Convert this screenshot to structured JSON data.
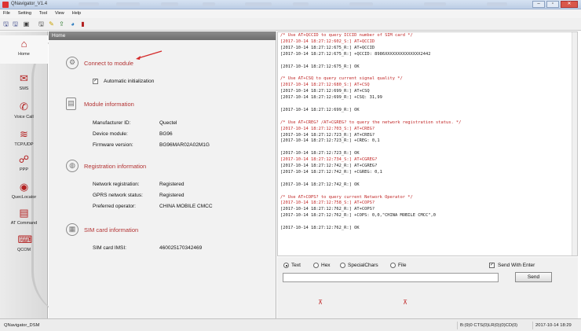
{
  "window": {
    "title": "QNavigator_V1.4"
  },
  "menu": [
    "File",
    "Setting",
    "Tool",
    "View",
    "Help"
  ],
  "toolbar": {
    "icons": [
      {
        "name": "save-icon",
        "glyph": "🖫",
        "color": "#2d3a80"
      },
      {
        "name": "save-as-icon",
        "glyph": "🖫",
        "color": "#2d3a80"
      },
      {
        "name": "new-document-icon",
        "glyph": "▣",
        "color": "#3b3b3b"
      },
      {
        "name": "disk-icon",
        "glyph": "🖫",
        "color": "#333333"
      },
      {
        "name": "edit-icon",
        "glyph": "✎",
        "color": "#c9a100"
      },
      {
        "name": "export-icon",
        "glyph": "⇪",
        "color": "#2c7a2c"
      },
      {
        "name": "globe-icon",
        "glyph": "◕",
        "color": "#2a7abf"
      },
      {
        "name": "book-icon",
        "glyph": "▮",
        "color": "#b32020"
      }
    ]
  },
  "sidebar": {
    "items": [
      {
        "label": "Home",
        "icon": "home-icon",
        "glyph": "⌂"
      },
      {
        "label": "SMS",
        "icon": "sms-icon",
        "glyph": "✉"
      },
      {
        "label": "Voice Call",
        "icon": "phone-icon",
        "glyph": "✆"
      },
      {
        "label": "TCP/UDP",
        "icon": "wifi-icon",
        "glyph": "≋"
      },
      {
        "label": "PPP",
        "icon": "network-icon",
        "glyph": "☍"
      },
      {
        "label": "QuecLocator",
        "icon": "locator-icon",
        "glyph": "◉"
      },
      {
        "label": "AT Command",
        "icon": "at-command-icon",
        "glyph": "▤"
      },
      {
        "label": "QCOM",
        "icon": "qcom-icon",
        "glyph": "⌨"
      }
    ]
  },
  "panel": {
    "header": "Home",
    "connect": {
      "title": "Connect to module",
      "auto_init_label": "Automatic initialization",
      "auto_init_checked": true
    },
    "module_info": {
      "title": "Module information",
      "rows": [
        {
          "label": "Manufacturer ID:",
          "value": "Quectel"
        },
        {
          "label": "Device module:",
          "value": "BG96"
        },
        {
          "label": "Firmware version:",
          "value": "BG96MAR02A02M1G"
        }
      ]
    },
    "registration": {
      "title": "Registration information",
      "rows": [
        {
          "label": "Network registration:",
          "value": "Registered"
        },
        {
          "label": "GPRS network status:",
          "value": "Registered"
        },
        {
          "label": "Preferred operator:",
          "value": "CHINA MOBILE CMCC"
        }
      ]
    },
    "sim": {
      "title": "SIM card information",
      "rows": [
        {
          "label": "SIM card IMSI:",
          "value": "460025170342469"
        }
      ]
    }
  },
  "log": [
    {
      "t": "/* Use AT+QCCID to query ICCID number of SIM card */",
      "k": "comment"
    },
    {
      "t": "[2017-10-14 18:27:12:602_S:] AT+QCCID",
      "k": "sent"
    },
    {
      "t": "[2017-10-14 18:27:12:675_R:] AT+QCCID",
      "k": "normal"
    },
    {
      "t": "[2017-10-14 18:27:12:675_R:] +QCCID: 8986XXXXXXXXXXXXXX2442",
      "k": "normal"
    },
    {
      "t": "",
      "k": "normal"
    },
    {
      "t": "[2017-10-14 18:27:12:675_R:] OK",
      "k": "normal"
    },
    {
      "t": "",
      "k": "normal"
    },
    {
      "t": "/* Use AT+CSQ to query current signal quality */",
      "k": "comment"
    },
    {
      "t": "[2017-10-14 18:27:12:680_S:] AT+CSQ",
      "k": "sent"
    },
    {
      "t": "[2017-10-14 18:27:12:699_R:] AT+CSQ",
      "k": "normal"
    },
    {
      "t": "[2017-10-14 18:27:12:699_R:] +CSQ: 31,99",
      "k": "normal"
    },
    {
      "t": "",
      "k": "normal"
    },
    {
      "t": "[2017-10-14 18:27:12:699_R:] OK",
      "k": "normal"
    },
    {
      "t": "",
      "k": "normal"
    },
    {
      "t": "/* Use AT+CREG? /AT+CGREG? to query the network registration status. */",
      "k": "comment"
    },
    {
      "t": "[2017-10-14 18:27:12:703_S:] AT+CREG?",
      "k": "sent"
    },
    {
      "t": "[2017-10-14 18:27:12:723_R:] AT+CREG?",
      "k": "normal"
    },
    {
      "t": "[2017-10-14 18:27:12:723_R:] +CREG: 0,1",
      "k": "normal"
    },
    {
      "t": "",
      "k": "normal"
    },
    {
      "t": "[2017-10-14 18:27:12:723_R:] OK",
      "k": "normal"
    },
    {
      "t": "[2017-10-14 18:27:12:734_S:] AT+CGREG?",
      "k": "sent"
    },
    {
      "t": "[2017-10-14 18:27:12:742_R:] AT+CGREG?",
      "k": "normal"
    },
    {
      "t": "[2017-10-14 18:27:12:742_R:] +CGREG: 0,1",
      "k": "normal"
    },
    {
      "t": "",
      "k": "normal"
    },
    {
      "t": "[2017-10-14 18:27:12:742_R:] OK",
      "k": "normal"
    },
    {
      "t": "",
      "k": "normal"
    },
    {
      "t": "/* Use AT+COPS? to query current Network Operator */",
      "k": "comment"
    },
    {
      "t": "[2017-10-14 18:27:12:758_S:] AT+COPS?",
      "k": "sent"
    },
    {
      "t": "[2017-10-14 18:27:12:762_R:] AT+COPS?",
      "k": "normal"
    },
    {
      "t": "[2017-10-14 18:27:12:762_R:] +COPS: 0,0,\"CHINA MOBILE CMCC\",0",
      "k": "normal"
    },
    {
      "t": "",
      "k": "normal"
    },
    {
      "t": "[2017-10-14 18:27:12:762_R:] OK",
      "k": "normal"
    }
  ],
  "send": {
    "radios": [
      {
        "label": "Text",
        "checked": true
      },
      {
        "label": "Hex",
        "checked": false
      },
      {
        "label": "SpecialChars",
        "checked": false
      },
      {
        "label": "File",
        "checked": false
      }
    ],
    "send_with_enter_label": "Send With Enter",
    "send_with_enter_checked": true,
    "input_value": "",
    "send_button": "Send"
  },
  "status": {
    "left": "QNavigator_DSM",
    "signals": "B:(9)0 CTS(0)LR(0)(0)CD(0)",
    "time": "2017-10-14 18:29"
  },
  "colors": {
    "accent_red": "#b33232",
    "log_red": "#c02626"
  }
}
